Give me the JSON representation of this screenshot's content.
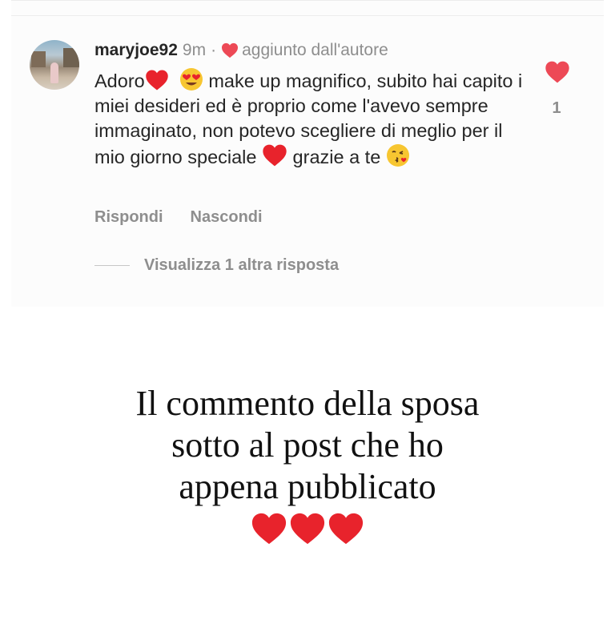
{
  "comment": {
    "username": "maryjoe92",
    "time": "9m",
    "separator": "·",
    "liked_by_author": "aggiunto dall'autore",
    "text_part1": "Adoro",
    "text_part2": "make up magnifico, subito hai capito i miei desideri ed è proprio come l'avevo sempre immaginato, non potevo scegliere di meglio per il mio giorno speciale",
    "text_part3": "grazie a te",
    "like_count": "1",
    "reply_label": "Rispondi",
    "hide_label": "Nascondi",
    "view_replies_label": "Visualizza 1 altra risposta"
  },
  "caption": {
    "line1": "Il commento della sposa",
    "line2": "sotto al post che ho",
    "line3": "appena pubblicato"
  },
  "icons": {
    "heart_color": "#ed4956",
    "emoji_heart_color": "#e8232c",
    "emoji_face_color": "#f7c631"
  }
}
